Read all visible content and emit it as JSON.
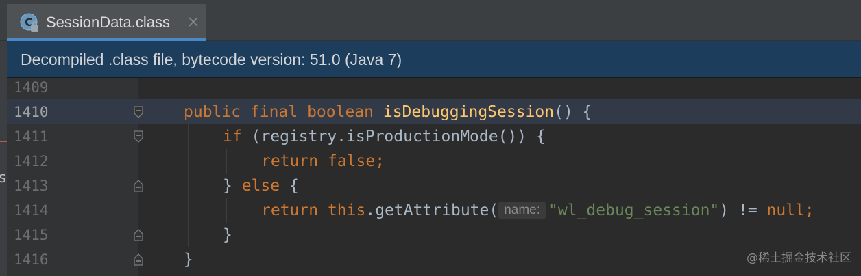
{
  "tab": {
    "file_name": "SessionData.class",
    "icon": "java-class-file-icon",
    "close_icon": "close-icon"
  },
  "banner": {
    "text": "Decompiled .class file, bytecode version: 51.0 (Java 7)"
  },
  "left_panel": {
    "visible_char": "s"
  },
  "editor": {
    "current_line": 1410,
    "line_numbers": [
      "1409",
      "1410",
      "1411",
      "1412",
      "1413",
      "1414",
      "1415",
      "1416"
    ],
    "code": {
      "l1410": {
        "kw1": "public",
        "kw2": "final",
        "kw3": "boolean",
        "method": "isDebuggingSession",
        "rest": "() {"
      },
      "l1411": {
        "kw": "if",
        "rest": " (registry.isProductionMode()) {"
      },
      "l1412": {
        "kw1": "return",
        "kw2": "false",
        "semi": ";"
      },
      "l1413": {
        "brace": "}",
        "kw": "else",
        "rest": " {"
      },
      "l1414": {
        "kw1": "return",
        "kw2": "this",
        "call": ".getAttribute(",
        "param_hint": "name:",
        "string": "\"wl_debug_session\"",
        "op": ") != ",
        "kw3": "null",
        "semi": ";"
      },
      "l1415": {
        "brace": "}"
      },
      "l1416": {
        "brace": "}"
      }
    }
  },
  "colors": {
    "background": "#2b2b2b",
    "keyword": "#cc7832",
    "method": "#ffc66d",
    "string": "#6a8759",
    "text": "#a9b7c6",
    "banner": "#1d3d5c",
    "tab_underline": "#4a88c7"
  },
  "watermark": {
    "text": "@稀土掘金技术社区"
  }
}
